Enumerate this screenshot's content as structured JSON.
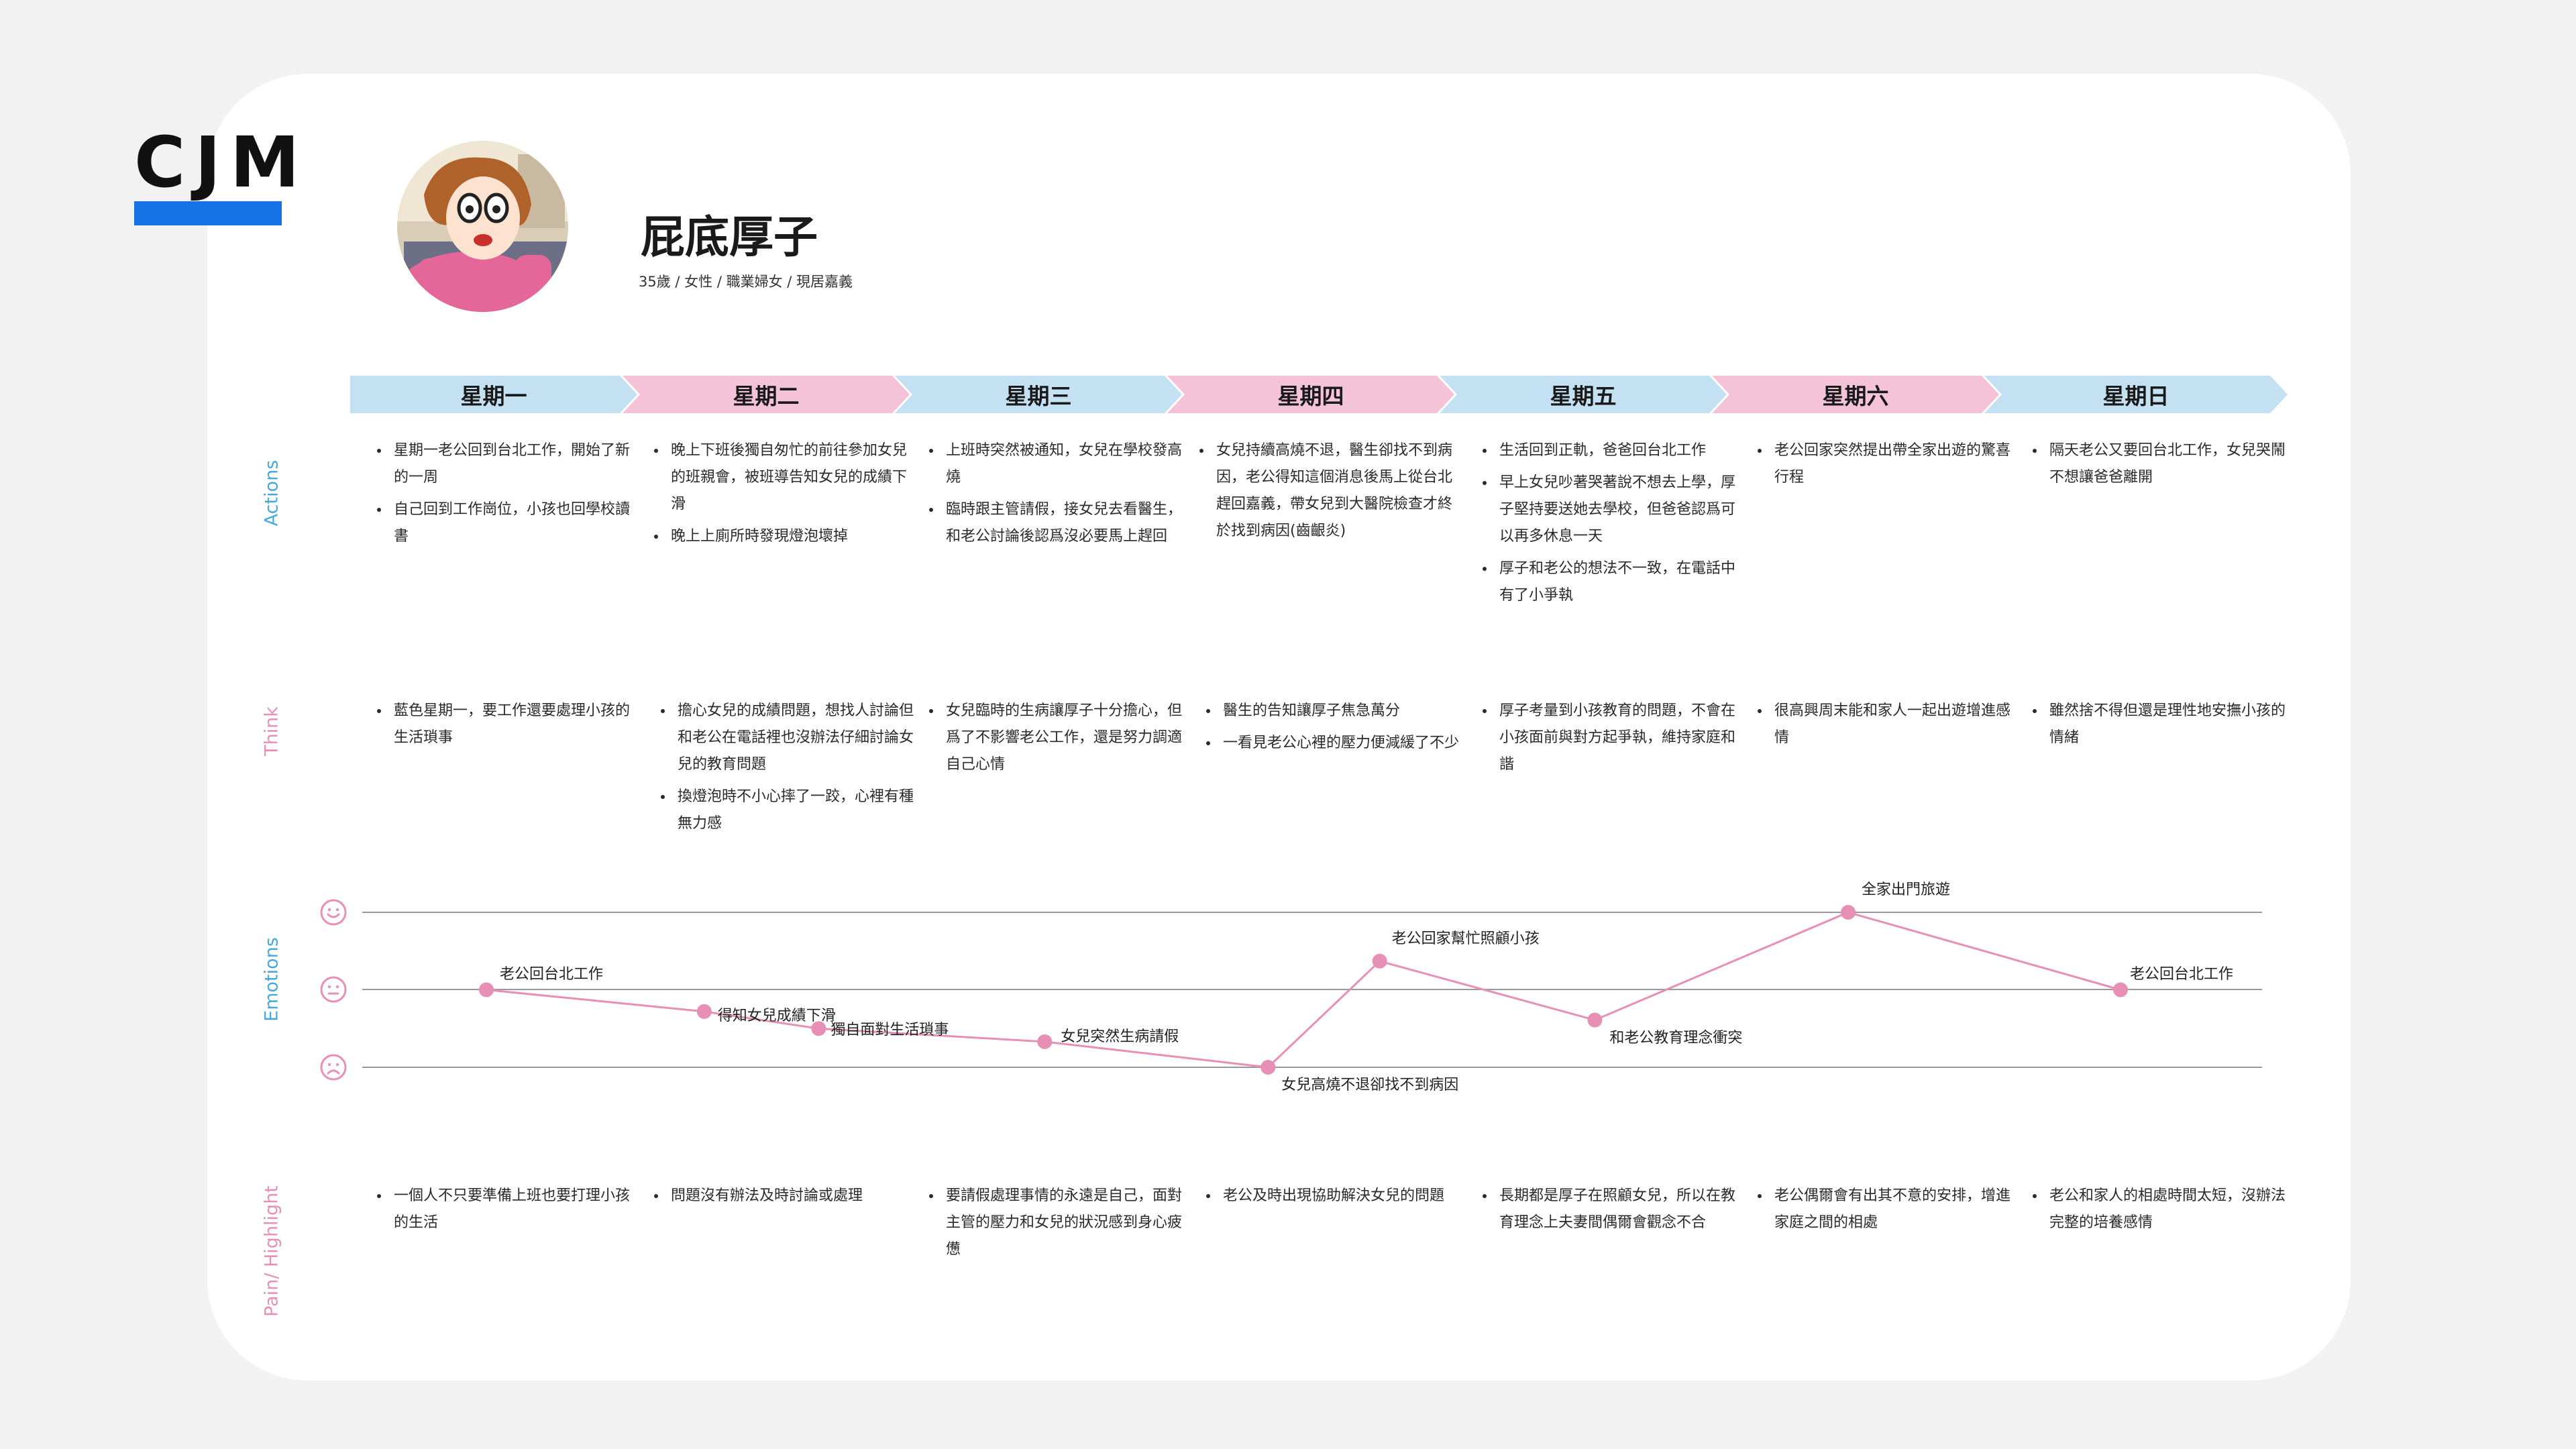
{
  "brand": {
    "logo_text": "CJM",
    "accent_blue": "#1573e6",
    "pink": "#e78fb5",
    "light_blue": "#c4e1f4",
    "light_pink": "#f4c3d7"
  },
  "persona": {
    "name": "屁底厚子",
    "meta": "35歲 / 女性 / 職業婦女 / 現居嘉義"
  },
  "row_labels": {
    "actions": "Actions",
    "think": "Think",
    "emotions": "Emotions",
    "pain": "Pain/ Highlight"
  },
  "days": [
    "星期一",
    "星期二",
    "星期三",
    "星期四",
    "星期五",
    "星期六",
    "星期日"
  ],
  "actions": [
    [
      "星期一老公回到台北工作，開始了新的一周",
      "自己回到工作崗位，小孩也回學校讀書"
    ],
    [
      "晚上下班後獨自匆忙的前往參加女兒的班親會，被班導告知女兒的成績下滑",
      "晚上上廁所時發現燈泡壞掉"
    ],
    [
      "上班時突然被通知，女兒在學校發高燒",
      "臨時跟主管請假，接女兒去看醫生，和老公討論後認爲沒必要馬上趕回"
    ],
    [
      "女兒持續高燒不退，醫生卻找不到病因，老公得知這個消息後馬上從台北趕回嘉義，帶女兒到大醫院檢查才終於找到病因(齒齦炎)"
    ],
    [
      "生活回到正軌，爸爸回台北工作",
      "早上女兒吵著哭著說不想去上學，厚子堅持要送她去學校，但爸爸認爲可以再多休息一天",
      "厚子和老公的想法不一致，在電話中有了小爭執"
    ],
    [
      "老公回家突然提出帶全家出遊的驚喜行程"
    ],
    [
      "隔天老公又要回台北工作，女兒哭鬧不想讓爸爸離開"
    ]
  ],
  "think": [
    [
      "藍色星期一，要工作還要處理小孩的生活瑣事"
    ],
    [
      "擔心女兒的成績問題，想找人討論但和老公在電話裡也沒辦法仔細討論女兒的教育問題",
      "換燈泡時不小心摔了一跤，心裡有種無力感"
    ],
    [
      "女兒臨時的生病讓厚子十分擔心，但爲了不影響老公工作，還是努力調適自己心情"
    ],
    [
      "醫生的告知讓厚子焦急萬分",
      "一看見老公心裡的壓力便減緩了不少"
    ],
    [
      "厚子考量到小孩教育的問題，不會在小孩面前與對方起爭執，維持家庭和諧"
    ],
    [
      "很高興周末能和家人一起出遊增進感情"
    ],
    [
      "雖然捨不得但還是理性地安撫小孩的情緒"
    ]
  ],
  "pain": [
    [
      "一個人不只要準備上班也要打理小孩的生活"
    ],
    [
      "問題沒有辦法及時討論或處理"
    ],
    [
      "要請假處理事情的永遠是自己，面對主管的壓力和女兒的狀況感到身心疲憊"
    ],
    [
      "老公及時出現協助解決女兒的問題"
    ],
    [
      "長期都是厚子在照顧女兒，所以在教育理念上夫妻間偶爾會觀念不合"
    ],
    [
      "老公偶爾會有出其不意的安排，增進家庭之間的相處"
    ],
    [
      "老公和家人的相處時間太短，沒辦法完整的培養感情"
    ]
  ],
  "chart_data": {
    "type": "line",
    "y_levels": [
      "positive",
      "neutral",
      "negative"
    ],
    "ylim": [
      -1,
      1
    ],
    "points": [
      {
        "x": 0.5,
        "y": 0,
        "label": "老公回台北工作"
      },
      {
        "x": 1.3,
        "y": -0.28,
        "label": "得知女兒成績下滑"
      },
      {
        "x": 1.72,
        "y": -0.5,
        "label": "獨自面對生活瑣事"
      },
      {
        "x": 2.55,
        "y": -0.67,
        "label": "女兒突然生病請假"
      },
      {
        "x": 3.37,
        "y": -1,
        "label": "女兒高燒不退卻找不到病因"
      },
      {
        "x": 3.78,
        "y": 0.37,
        "label": "老公回家幫忙照顧小孩"
      },
      {
        "x": 4.57,
        "y": -0.39,
        "label": "和老公教育理念衝突"
      },
      {
        "x": 5.5,
        "y": 1,
        "label": "全家出門旅遊"
      },
      {
        "x": 6.5,
        "y": 0,
        "label": "老公回台北工作"
      }
    ]
  }
}
